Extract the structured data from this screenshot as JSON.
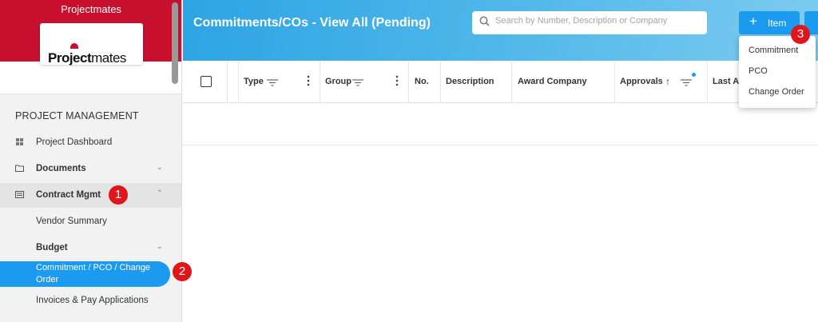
{
  "sidebar": {
    "brand_title": "Projectmates",
    "logo_bold": "Project",
    "logo_light": "mates",
    "section_label": "PROJECT MANAGEMENT",
    "items": [
      {
        "label": "Project Dashboard",
        "icon": "dashboard-icon"
      },
      {
        "label": "Documents",
        "icon": "folder-icon"
      },
      {
        "label": "Contract Mgmt",
        "icon": "contract-icon"
      },
      {
        "label": "Vendor Summary"
      },
      {
        "label": "Budget"
      },
      {
        "label": "Commitment / PCO / Change Order",
        "line1": "Commitment / PCO / Change",
        "line2": "Order"
      },
      {
        "label": "Invoices & Pay Applications"
      }
    ]
  },
  "header": {
    "title": "Commitments/COs - View All (Pending)",
    "search_placeholder": "Search by Number, Description or Company",
    "item_button_label": "Item",
    "item_button_plus": "+"
  },
  "table": {
    "columns": [
      "Type",
      "Group",
      "No.",
      "Description",
      "Award Company",
      "Approvals",
      "Last A"
    ],
    "approvals_sort_icon": "↑"
  },
  "dropdown": {
    "items": [
      "Commitment",
      "PCO",
      "Change Order"
    ]
  },
  "badges": [
    "1",
    "2",
    "3"
  ],
  "colors": {
    "brand_red": "#c8102e",
    "accent_blue": "#1a9bf0",
    "badge_red": "#e0161b"
  }
}
